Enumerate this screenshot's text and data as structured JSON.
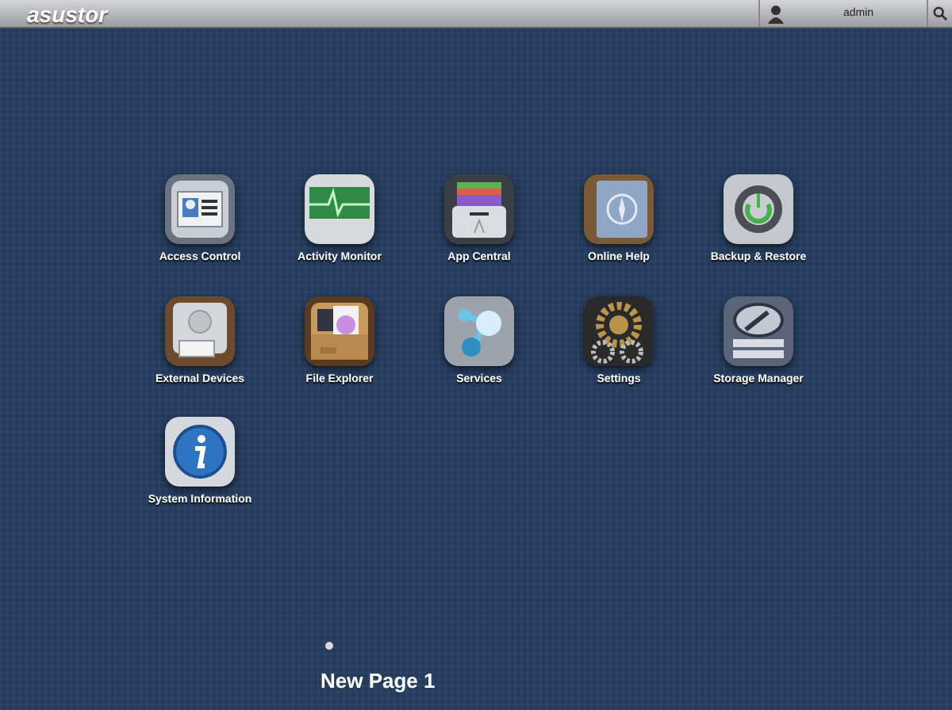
{
  "top_bar": {
    "logo": "asustor",
    "user": "admin"
  },
  "apps": [
    {
      "label": "Access Control",
      "kind": "card"
    },
    {
      "label": "Activity Monitor",
      "kind": "pulse"
    },
    {
      "label": "App Central",
      "kind": "drawer"
    },
    {
      "label": "Online Help",
      "kind": "compass"
    },
    {
      "label": "Backup & Restore",
      "kind": "power"
    },
    {
      "label": "External Devices",
      "kind": "drive"
    },
    {
      "label": "File Explorer",
      "kind": "folder"
    },
    {
      "label": "Services",
      "kind": "molecule"
    },
    {
      "label": "Settings",
      "kind": "gears"
    },
    {
      "label": "Storage Manager",
      "kind": "tools"
    },
    {
      "label": "System Information",
      "kind": "info"
    }
  ],
  "pages": [
    {
      "title": "New Page 1",
      "selected": true
    }
  ]
}
